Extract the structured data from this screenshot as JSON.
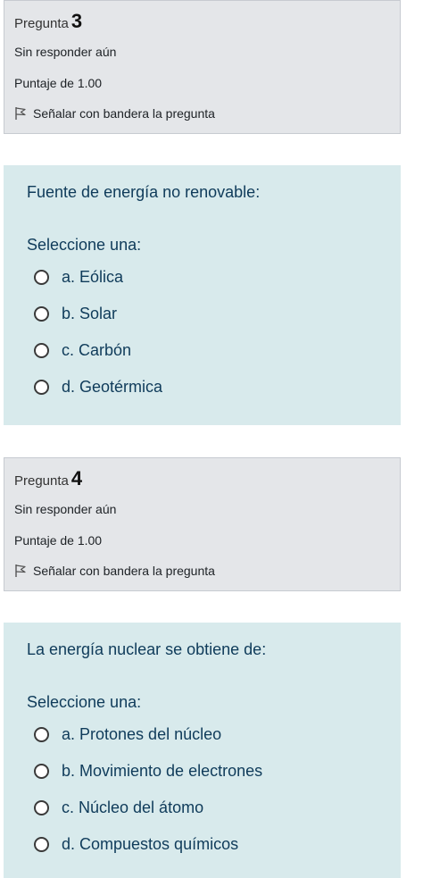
{
  "questions": [
    {
      "info": {
        "label": "Pregunta",
        "number": "3",
        "status": "Sin responder aún",
        "score": "Puntaje de 1.00",
        "flag_label": "Señalar con bandera la pregunta",
        "flag_icon": "flag-outline-icon"
      },
      "content": {
        "text": "Fuente de energía no renovable:",
        "prompt": "Seleccione una:",
        "options": [
          "a. Eólica",
          "b. Solar",
          "c. Carbón",
          "d. Geotérmica"
        ]
      }
    },
    {
      "info": {
        "label": "Pregunta",
        "number": "4",
        "status": "Sin responder aún",
        "score": "Puntaje de 1.00",
        "flag_label": "Señalar con bandera la pregunta",
        "flag_icon": "flag-outline-icon"
      },
      "content": {
        "text": "La energía nuclear se obtiene de:",
        "prompt": "Seleccione una:",
        "options": [
          "a. Protones del núcleo",
          "b. Movimiento de electrones",
          "c. Núcleo del átomo",
          "d. Compuestos químicos"
        ]
      }
    }
  ],
  "colors": {
    "info_bg": "#e4e6e9",
    "content_bg": "#d8eaec",
    "question_text": "#0f3b5a"
  }
}
